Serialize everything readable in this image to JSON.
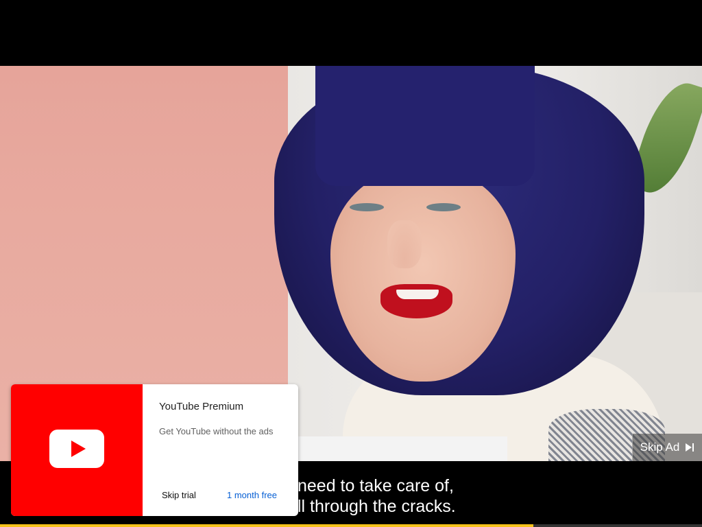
{
  "ad": {
    "skip_label": "Skip Ad",
    "skip_icon": "skip-next-icon"
  },
  "captions": {
    "line1": "need to take care of,",
    "line2": "ll through the cracks."
  },
  "progress": {
    "fraction": 0.76,
    "color": "#f5c21b"
  },
  "premium": {
    "brand_icon": "youtube-play-icon",
    "brand_color": "#ff0000",
    "title": "YouTube Premium",
    "subtitle": "Get YouTube without the ads",
    "skip_trial_label": "Skip trial",
    "offer_label": "1 month free",
    "offer_color": "#065fd4"
  }
}
